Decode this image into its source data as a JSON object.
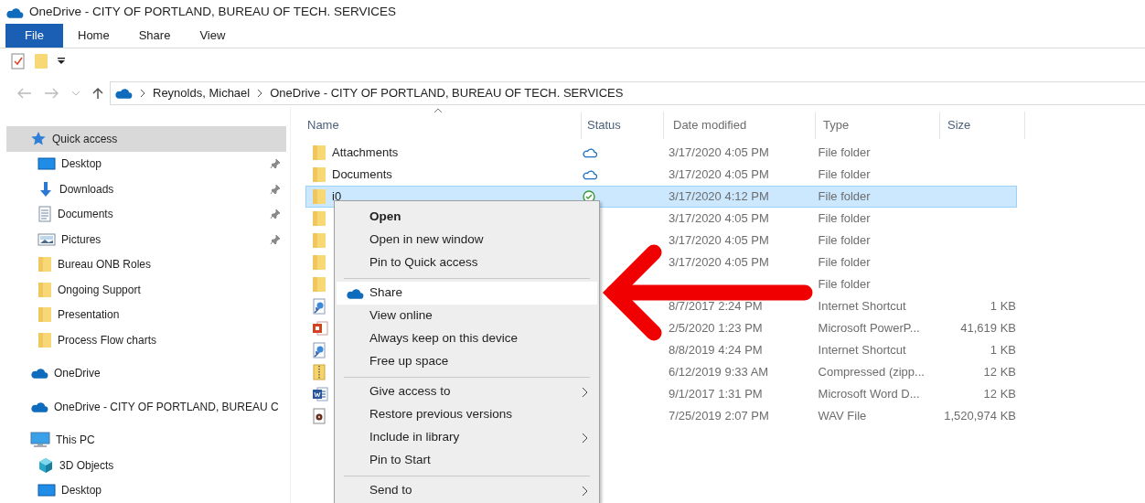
{
  "window": {
    "title": "OneDrive - CITY OF PORTLAND, BUREAU OF TECH. SERVICES"
  },
  "ribbon_tabs": [
    {
      "label": "File",
      "selected": true
    },
    {
      "label": "Home",
      "selected": false
    },
    {
      "label": "Share",
      "selected": false
    },
    {
      "label": "View",
      "selected": false
    }
  ],
  "address_bar": {
    "path": [
      "Reynolds, Michael",
      "OneDrive - CITY OF PORTLAND, BUREAU OF TECH. SERVICES"
    ]
  },
  "sidebar": {
    "items": [
      {
        "label": "Quick access",
        "kind": "star",
        "selected": true,
        "children": [
          {
            "label": "Desktop",
            "kind": "desktop",
            "pinned": true
          },
          {
            "label": "Downloads",
            "kind": "downloads",
            "pinned": true
          },
          {
            "label": "Documents",
            "kind": "documents",
            "pinned": true
          },
          {
            "label": "Pictures",
            "kind": "pictures",
            "pinned": true
          },
          {
            "label": "Bureau ONB Roles",
            "kind": "folder",
            "pinned": false
          },
          {
            "label": "Ongoing Support",
            "kind": "folder",
            "pinned": false
          },
          {
            "label": "Presentation",
            "kind": "folder",
            "pinned": false
          },
          {
            "label": "Process Flow charts",
            "kind": "folder",
            "pinned": false
          }
        ]
      },
      {
        "label": "OneDrive",
        "kind": "cloud",
        "selected": false
      },
      {
        "label": "OneDrive - CITY OF PORTLAND, BUREAU C",
        "kind": "cloud",
        "selected": false
      },
      {
        "label": "This PC",
        "kind": "pc",
        "selected": false,
        "children": [
          {
            "label": "3D Objects",
            "kind": "cube",
            "pinned": false
          },
          {
            "label": "Desktop",
            "kind": "desktop",
            "pinned": false
          }
        ]
      }
    ]
  },
  "files": {
    "columns": [
      "Name",
      "Status",
      "Date modified",
      "Type",
      "Size"
    ],
    "rows": [
      {
        "name": "Attachments",
        "kind": "folder",
        "synced": false,
        "date": "3/17/2020 4:05 PM",
        "type": "File folder",
        "selected": false
      },
      {
        "name": "Documents",
        "kind": "folder",
        "synced": false,
        "date": "3/17/2020 4:05 PM",
        "type": "File folder",
        "selected": false
      },
      {
        "name": "i0",
        "kind": "folder",
        "synced": true,
        "date": "3/17/2020 4:12 PM",
        "type": "File folder",
        "selected": true
      },
      {
        "kind": "folder",
        "date": "3/17/2020 4:05 PM",
        "type": "File folder",
        "selected": false
      },
      {
        "kind": "folder",
        "date": "3/17/2020 4:05 PM",
        "type": "File folder",
        "selected": false
      },
      {
        "kind": "folder",
        "date": "3/17/2020 4:05 PM",
        "type": "File folder",
        "selected": false
      },
      {
        "kind": "folder",
        "type": "File folder",
        "selected": false
      },
      {
        "kind": "shortcut",
        "date": "8/7/2017 2:24 PM",
        "type": "Internet Shortcut",
        "size": "1 KB",
        "selected": false
      },
      {
        "kind": "slides",
        "date": "2/5/2020 1:23 PM",
        "type": "Microsoft PowerP...",
        "size": "41,619 KB",
        "selected": false
      },
      {
        "kind": "shortcut",
        "date": "8/8/2019 4:24 PM",
        "type": "Internet Shortcut",
        "size": "1 KB",
        "selected": false
      },
      {
        "kind": "zip",
        "date": "6/12/2019 9:33 AM",
        "type": "Compressed (zipp...",
        "size": "12 KB",
        "selected": false
      },
      {
        "kind": "doc",
        "date": "9/1/2017 1:31 PM",
        "type": "Microsoft Word D...",
        "size": "12 KB",
        "selected": false
      },
      {
        "kind": "audio",
        "date": "7/25/2019 2:07 PM",
        "type": "WAV File",
        "size": "1,520,974 KB",
        "selected": false
      }
    ]
  },
  "context_menu": {
    "items": [
      {
        "kind": "default",
        "label": "Open",
        "submenu": false,
        "highlighted": false
      },
      {
        "kind": "item",
        "label": "Open in new window",
        "submenu": false,
        "highlighted": false
      },
      {
        "kind": "item",
        "label": "Pin to Quick access",
        "submenu": false,
        "highlighted": false
      },
      {
        "kind": "separator"
      },
      {
        "kind": "cloud",
        "label": "Share",
        "submenu": false,
        "highlighted": true
      },
      {
        "kind": "item",
        "label": "View online",
        "submenu": false,
        "highlighted": false
      },
      {
        "kind": "item",
        "label": "Always keep on this device",
        "submenu": false,
        "highlighted": false
      },
      {
        "kind": "item",
        "label": "Free up space",
        "submenu": false,
        "highlighted": false
      },
      {
        "kind": "separator"
      },
      {
        "kind": "item",
        "label": "Give access to",
        "submenu": true,
        "highlighted": false
      },
      {
        "kind": "item",
        "label": "Restore previous versions",
        "submenu": false,
        "highlighted": false
      },
      {
        "kind": "item",
        "label": "Include in library",
        "submenu": true,
        "highlighted": false
      },
      {
        "kind": "item",
        "label": "Pin to Start",
        "submenu": false,
        "highlighted": false
      },
      {
        "kind": "separator"
      },
      {
        "kind": "item",
        "label": "Send to",
        "submenu": true,
        "highlighted": false
      }
    ]
  }
}
